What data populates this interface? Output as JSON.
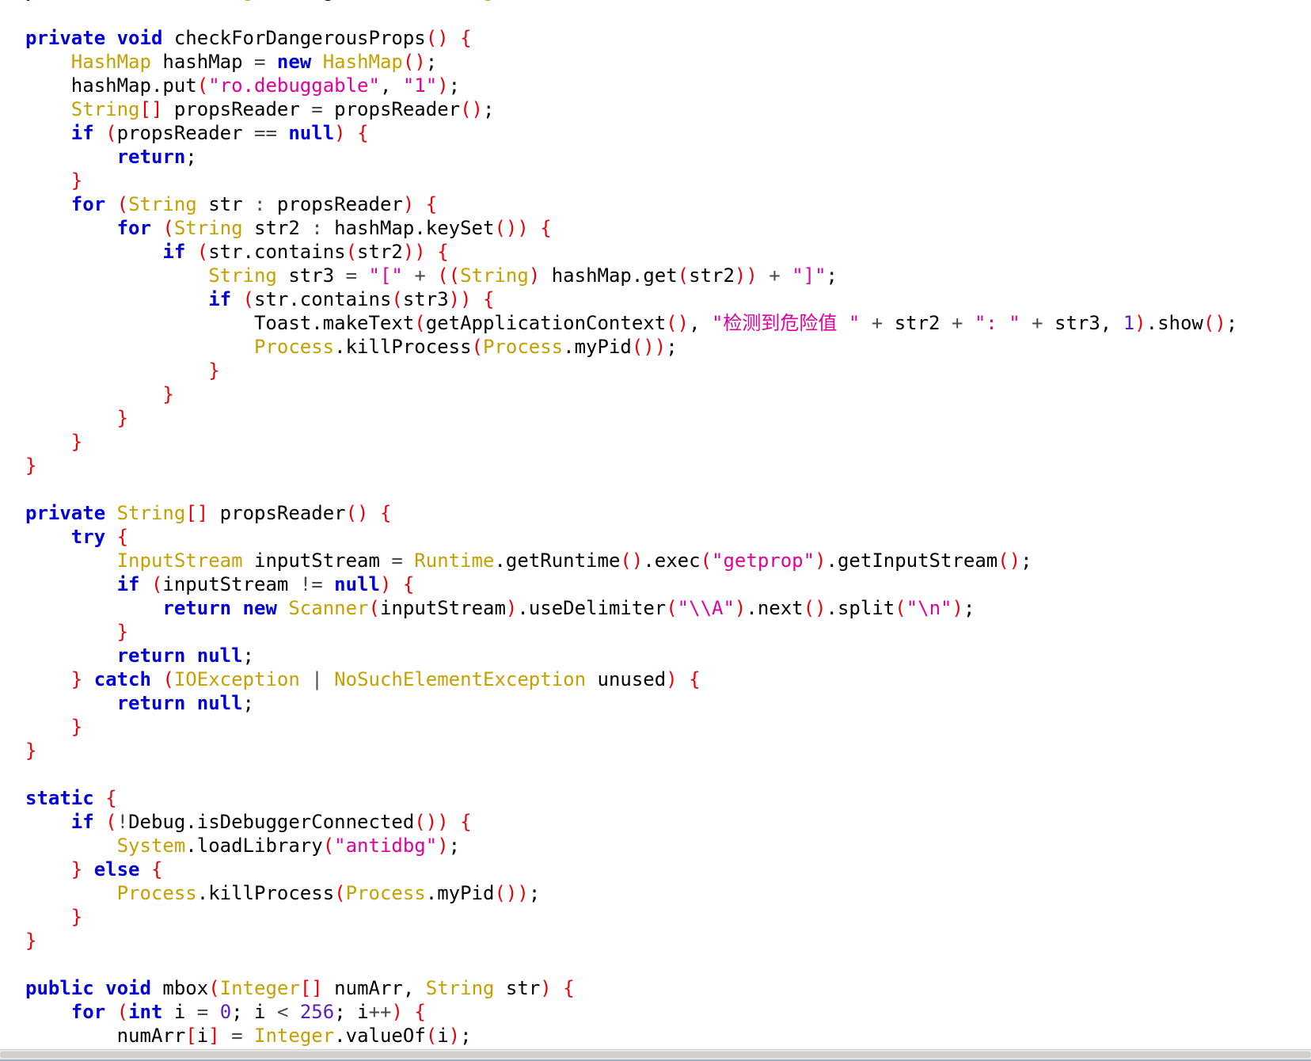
{
  "editor": {
    "language": "java",
    "token_colors": {
      "keyword": "#0000d8",
      "type": "#c5a000",
      "string": "#e0009a",
      "number": "#5a1fc4",
      "punctuation": "#e8000b",
      "operator": "#4a4a4a",
      "identifier": "#000000"
    },
    "lines": [
      [
        [
          "kw",
          "public"
        ],
        [
          "id",
          " "
        ],
        [
          "ty",
          "native"
        ],
        [
          "id",
          " "
        ],
        [
          "ty",
          "String"
        ],
        [
          "id",
          " stringFromJNI"
        ],
        [
          "pn",
          "("
        ],
        [
          "ty",
          "String"
        ],
        [
          "id",
          " str"
        ],
        [
          "pn",
          ")"
        ],
        [
          "id",
          ";"
        ]
      ],
      [],
      [
        [
          "kw",
          "private"
        ],
        [
          "id",
          " "
        ],
        [
          "kw",
          "void"
        ],
        [
          "id",
          " checkForDangerousProps"
        ],
        [
          "pn",
          "()"
        ],
        [
          "id",
          " "
        ],
        [
          "pn",
          "{"
        ]
      ],
      [
        [
          "id",
          "    "
        ],
        [
          "ty",
          "HashMap"
        ],
        [
          "id",
          " hashMap "
        ],
        [
          "op",
          "="
        ],
        [
          "id",
          " "
        ],
        [
          "kw",
          "new"
        ],
        [
          "id",
          " "
        ],
        [
          "ty",
          "HashMap"
        ],
        [
          "pn",
          "()"
        ],
        [
          "id",
          ";"
        ]
      ],
      [
        [
          "id",
          "    hashMap.put"
        ],
        [
          "pn",
          "("
        ],
        [
          "str",
          "\"ro.debuggable\""
        ],
        [
          "id",
          ", "
        ],
        [
          "str",
          "\"1\""
        ],
        [
          "pn",
          ")"
        ],
        [
          "id",
          ";"
        ]
      ],
      [
        [
          "id",
          "    "
        ],
        [
          "ty",
          "String"
        ],
        [
          "pn",
          "[]"
        ],
        [
          "id",
          " propsReader "
        ],
        [
          "op",
          "="
        ],
        [
          "id",
          " propsReader"
        ],
        [
          "pn",
          "()"
        ],
        [
          "id",
          ";"
        ]
      ],
      [
        [
          "id",
          "    "
        ],
        [
          "kw",
          "if"
        ],
        [
          "id",
          " "
        ],
        [
          "pn",
          "("
        ],
        [
          "id",
          "propsReader "
        ],
        [
          "op",
          "=="
        ],
        [
          "id",
          " "
        ],
        [
          "kw",
          "null"
        ],
        [
          "pn",
          ")"
        ],
        [
          "id",
          " "
        ],
        [
          "pn",
          "{"
        ]
      ],
      [
        [
          "id",
          "        "
        ],
        [
          "kw",
          "return"
        ],
        [
          "id",
          ";"
        ]
      ],
      [
        [
          "id",
          "    "
        ],
        [
          "pn",
          "}"
        ]
      ],
      [
        [
          "id",
          "    "
        ],
        [
          "kw",
          "for"
        ],
        [
          "id",
          " "
        ],
        [
          "pn",
          "("
        ],
        [
          "ty",
          "String"
        ],
        [
          "id",
          " str "
        ],
        [
          "op",
          ":"
        ],
        [
          "id",
          " propsReader"
        ],
        [
          "pn",
          ")"
        ],
        [
          "id",
          " "
        ],
        [
          "pn",
          "{"
        ]
      ],
      [
        [
          "id",
          "        "
        ],
        [
          "kw",
          "for"
        ],
        [
          "id",
          " "
        ],
        [
          "pn",
          "("
        ],
        [
          "ty",
          "String"
        ],
        [
          "id",
          " str2 "
        ],
        [
          "op",
          ":"
        ],
        [
          "id",
          " hashMap.keySet"
        ],
        [
          "pn",
          "())"
        ],
        [
          "id",
          " "
        ],
        [
          "pn",
          "{"
        ]
      ],
      [
        [
          "id",
          "            "
        ],
        [
          "kw",
          "if"
        ],
        [
          "id",
          " "
        ],
        [
          "pn",
          "("
        ],
        [
          "id",
          "str.contains"
        ],
        [
          "pn",
          "("
        ],
        [
          "id",
          "str2"
        ],
        [
          "pn",
          "))"
        ],
        [
          "id",
          " "
        ],
        [
          "pn",
          "{"
        ]
      ],
      [
        [
          "id",
          "                "
        ],
        [
          "ty",
          "String"
        ],
        [
          "id",
          " str3 "
        ],
        [
          "op",
          "="
        ],
        [
          "id",
          " "
        ],
        [
          "str",
          "\"[\""
        ],
        [
          "id",
          " "
        ],
        [
          "op",
          "+"
        ],
        [
          "id",
          " "
        ],
        [
          "pn",
          "(("
        ],
        [
          "ty",
          "String"
        ],
        [
          "pn",
          ")"
        ],
        [
          "id",
          " hashMap.get"
        ],
        [
          "pn",
          "("
        ],
        [
          "id",
          "str2"
        ],
        [
          "pn",
          "))"
        ],
        [
          "id",
          " "
        ],
        [
          "op",
          "+"
        ],
        [
          "id",
          " "
        ],
        [
          "str",
          "\"]\""
        ],
        [
          "id",
          ";"
        ]
      ],
      [
        [
          "id",
          "                "
        ],
        [
          "kw",
          "if"
        ],
        [
          "id",
          " "
        ],
        [
          "pn",
          "("
        ],
        [
          "id",
          "str.contains"
        ],
        [
          "pn",
          "("
        ],
        [
          "id",
          "str3"
        ],
        [
          "pn",
          "))"
        ],
        [
          "id",
          " "
        ],
        [
          "pn",
          "{"
        ]
      ],
      [
        [
          "id",
          "                    Toast.makeText"
        ],
        [
          "pn",
          "("
        ],
        [
          "id",
          "getApplicationContext"
        ],
        [
          "pn",
          "()"
        ],
        [
          "id",
          ", "
        ],
        [
          "str",
          "\"检测到危险值 \""
        ],
        [
          "id",
          " "
        ],
        [
          "op",
          "+"
        ],
        [
          "id",
          " str2 "
        ],
        [
          "op",
          "+"
        ],
        [
          "id",
          " "
        ],
        [
          "str",
          "\": \""
        ],
        [
          "id",
          " "
        ],
        [
          "op",
          "+"
        ],
        [
          "id",
          " str3, "
        ],
        [
          "num",
          "1"
        ],
        [
          "pn",
          ")"
        ],
        [
          "id",
          ".show"
        ],
        [
          "pn",
          "()"
        ],
        [
          "id",
          ";"
        ]
      ],
      [
        [
          "id",
          "                    "
        ],
        [
          "ty",
          "Process"
        ],
        [
          "id",
          ".killProcess"
        ],
        [
          "pn",
          "("
        ],
        [
          "ty",
          "Process"
        ],
        [
          "id",
          ".myPid"
        ],
        [
          "pn",
          "())"
        ],
        [
          "id",
          ";"
        ]
      ],
      [
        [
          "id",
          "                "
        ],
        [
          "pn",
          "}"
        ]
      ],
      [
        [
          "id",
          "            "
        ],
        [
          "pn",
          "}"
        ]
      ],
      [
        [
          "id",
          "        "
        ],
        [
          "pn",
          "}"
        ]
      ],
      [
        [
          "id",
          "    "
        ],
        [
          "pn",
          "}"
        ]
      ],
      [
        [
          "pn",
          "}"
        ]
      ],
      [],
      [
        [
          "kw",
          "private"
        ],
        [
          "id",
          " "
        ],
        [
          "ty",
          "String"
        ],
        [
          "pn",
          "[]"
        ],
        [
          "id",
          " propsReader"
        ],
        [
          "pn",
          "()"
        ],
        [
          "id",
          " "
        ],
        [
          "pn",
          "{"
        ]
      ],
      [
        [
          "id",
          "    "
        ],
        [
          "kw",
          "try"
        ],
        [
          "id",
          " "
        ],
        [
          "pn",
          "{"
        ]
      ],
      [
        [
          "id",
          "        "
        ],
        [
          "ty",
          "InputStream"
        ],
        [
          "id",
          " inputStream "
        ],
        [
          "op",
          "="
        ],
        [
          "id",
          " "
        ],
        [
          "ty",
          "Runtime"
        ],
        [
          "id",
          ".getRuntime"
        ],
        [
          "pn",
          "()"
        ],
        [
          "id",
          ".exec"
        ],
        [
          "pn",
          "("
        ],
        [
          "str",
          "\"getprop\""
        ],
        [
          "pn",
          ")"
        ],
        [
          "id",
          ".getInputStream"
        ],
        [
          "pn",
          "()"
        ],
        [
          "id",
          ";"
        ]
      ],
      [
        [
          "id",
          "        "
        ],
        [
          "kw",
          "if"
        ],
        [
          "id",
          " "
        ],
        [
          "pn",
          "("
        ],
        [
          "id",
          "inputStream "
        ],
        [
          "op",
          "!="
        ],
        [
          "id",
          " "
        ],
        [
          "kw",
          "null"
        ],
        [
          "pn",
          ")"
        ],
        [
          "id",
          " "
        ],
        [
          "pn",
          "{"
        ]
      ],
      [
        [
          "id",
          "            "
        ],
        [
          "kw",
          "return"
        ],
        [
          "id",
          " "
        ],
        [
          "kw",
          "new"
        ],
        [
          "id",
          " "
        ],
        [
          "ty",
          "Scanner"
        ],
        [
          "pn",
          "("
        ],
        [
          "id",
          "inputStream"
        ],
        [
          "pn",
          ")"
        ],
        [
          "id",
          ".useDelimiter"
        ],
        [
          "pn",
          "("
        ],
        [
          "str",
          "\"\\\\A\""
        ],
        [
          "pn",
          ")"
        ],
        [
          "id",
          ".next"
        ],
        [
          "pn",
          "()"
        ],
        [
          "id",
          ".split"
        ],
        [
          "pn",
          "("
        ],
        [
          "str",
          "\"\\n\""
        ],
        [
          "pn",
          ")"
        ],
        [
          "id",
          ";"
        ]
      ],
      [
        [
          "id",
          "        "
        ],
        [
          "pn",
          "}"
        ]
      ],
      [
        [
          "id",
          "        "
        ],
        [
          "kw",
          "return"
        ],
        [
          "id",
          " "
        ],
        [
          "kw",
          "null"
        ],
        [
          "id",
          ";"
        ]
      ],
      [
        [
          "id",
          "    "
        ],
        [
          "pn",
          "}"
        ],
        [
          "id",
          " "
        ],
        [
          "kw",
          "catch"
        ],
        [
          "id",
          " "
        ],
        [
          "pn",
          "("
        ],
        [
          "ty",
          "IOException"
        ],
        [
          "id",
          " "
        ],
        [
          "op",
          "|"
        ],
        [
          "id",
          " "
        ],
        [
          "ty",
          "NoSuchElementException"
        ],
        [
          "id",
          " unused"
        ],
        [
          "pn",
          ")"
        ],
        [
          "id",
          " "
        ],
        [
          "pn",
          "{"
        ]
      ],
      [
        [
          "id",
          "        "
        ],
        [
          "kw",
          "return"
        ],
        [
          "id",
          " "
        ],
        [
          "kw",
          "null"
        ],
        [
          "id",
          ";"
        ]
      ],
      [
        [
          "id",
          "    "
        ],
        [
          "pn",
          "}"
        ]
      ],
      [
        [
          "pn",
          "}"
        ]
      ],
      [],
      [
        [
          "kw",
          "static"
        ],
        [
          "id",
          " "
        ],
        [
          "pn",
          "{"
        ]
      ],
      [
        [
          "id",
          "    "
        ],
        [
          "kw",
          "if"
        ],
        [
          "id",
          " "
        ],
        [
          "pn",
          "("
        ],
        [
          "op",
          "!"
        ],
        [
          "id",
          "Debug.isDebuggerConnected"
        ],
        [
          "pn",
          "())"
        ],
        [
          "id",
          " "
        ],
        [
          "pn",
          "{"
        ]
      ],
      [
        [
          "id",
          "        "
        ],
        [
          "ty",
          "System"
        ],
        [
          "id",
          ".loadLibrary"
        ],
        [
          "pn",
          "("
        ],
        [
          "str",
          "\"antidbg\""
        ],
        [
          "pn",
          ")"
        ],
        [
          "id",
          ";"
        ]
      ],
      [
        [
          "id",
          "    "
        ],
        [
          "pn",
          "}"
        ],
        [
          "id",
          " "
        ],
        [
          "kw",
          "else"
        ],
        [
          "id",
          " "
        ],
        [
          "pn",
          "{"
        ]
      ],
      [
        [
          "id",
          "        "
        ],
        [
          "ty",
          "Process"
        ],
        [
          "id",
          ".killProcess"
        ],
        [
          "pn",
          "("
        ],
        [
          "ty",
          "Process"
        ],
        [
          "id",
          ".myPid"
        ],
        [
          "pn",
          "())"
        ],
        [
          "id",
          ";"
        ]
      ],
      [
        [
          "id",
          "    "
        ],
        [
          "pn",
          "}"
        ]
      ],
      [
        [
          "pn",
          "}"
        ]
      ],
      [],
      [
        [
          "kw",
          "public"
        ],
        [
          "id",
          " "
        ],
        [
          "kw",
          "void"
        ],
        [
          "id",
          " mbox"
        ],
        [
          "pn",
          "("
        ],
        [
          "ty",
          "Integer"
        ],
        [
          "pn",
          "[]"
        ],
        [
          "id",
          " numArr, "
        ],
        [
          "ty",
          "String"
        ],
        [
          "id",
          " str"
        ],
        [
          "pn",
          ")"
        ],
        [
          "id",
          " "
        ],
        [
          "pn",
          "{"
        ]
      ],
      [
        [
          "id",
          "    "
        ],
        [
          "kw",
          "for"
        ],
        [
          "id",
          " "
        ],
        [
          "pn",
          "("
        ],
        [
          "kw",
          "int"
        ],
        [
          "id",
          " i "
        ],
        [
          "op",
          "="
        ],
        [
          "id",
          " "
        ],
        [
          "num",
          "0"
        ],
        [
          "id",
          "; i "
        ],
        [
          "op",
          "<"
        ],
        [
          "id",
          " "
        ],
        [
          "num",
          "256"
        ],
        [
          "id",
          "; i"
        ],
        [
          "op",
          "++"
        ],
        [
          "pn",
          ")"
        ],
        [
          "id",
          " "
        ],
        [
          "pn",
          "{"
        ]
      ],
      [
        [
          "id",
          "        numArr"
        ],
        [
          "pn",
          "["
        ],
        [
          "id",
          "i"
        ],
        [
          "pn",
          "]"
        ],
        [
          "id",
          " "
        ],
        [
          "op",
          "="
        ],
        [
          "id",
          " "
        ],
        [
          "ty",
          "Integer"
        ],
        [
          "id",
          ".valueOf"
        ],
        [
          "pn",
          "("
        ],
        [
          "id",
          "i"
        ],
        [
          "pn",
          ")"
        ],
        [
          "id",
          ";"
        ]
      ]
    ]
  }
}
